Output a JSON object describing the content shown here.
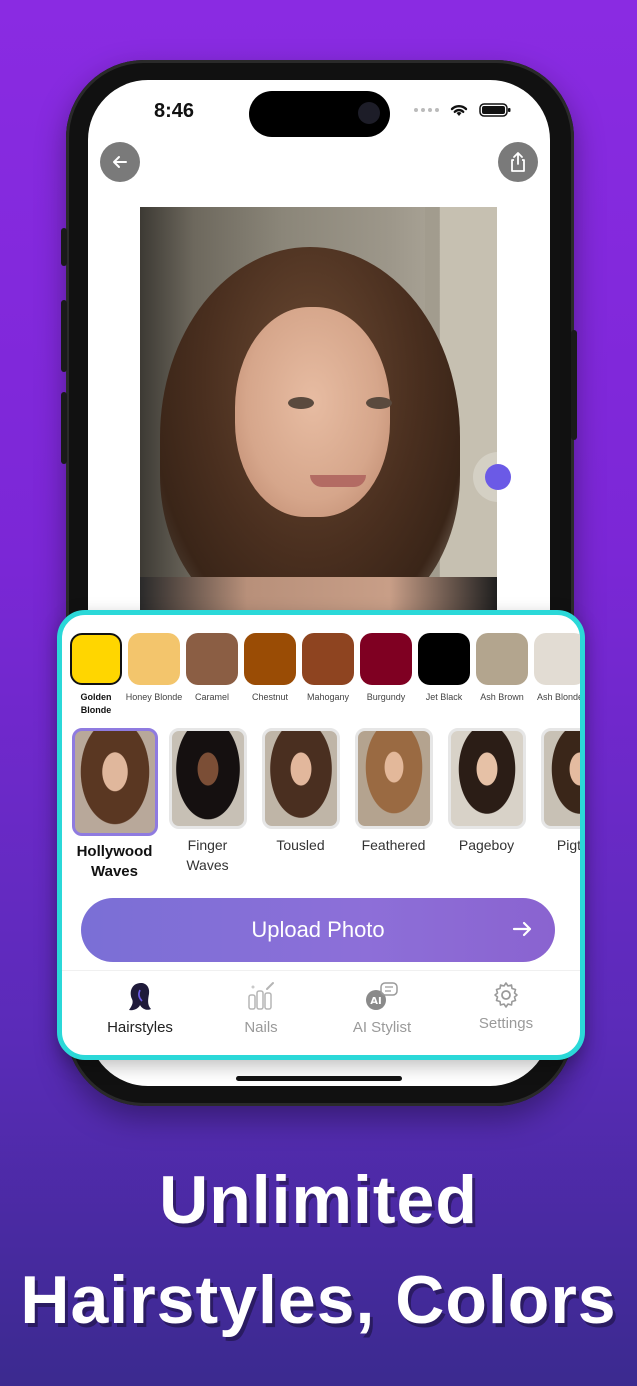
{
  "status": {
    "time": "8:46"
  },
  "colors": {
    "selected_index": 0,
    "items": [
      {
        "label": "Golden Blonde",
        "color": "#ffd600"
      },
      {
        "label": "Honey Blonde",
        "color": "#f3c56c"
      },
      {
        "label": "Caramel",
        "color": "#8b5e44"
      },
      {
        "label": "Chestnut",
        "color": "#9a4c05"
      },
      {
        "label": "Mahogany",
        "color": "#8e4420"
      },
      {
        "label": "Burgundy",
        "color": "#7f0022"
      },
      {
        "label": "Jet Black",
        "color": "#000000"
      },
      {
        "label": "Ash Brown",
        "color": "#b3a58e"
      },
      {
        "label": "Ash Blonde",
        "color": "#e2dcd3"
      }
    ]
  },
  "styles": {
    "selected_index": 0,
    "items": [
      {
        "label": "Hollywood Waves"
      },
      {
        "label": "Finger Waves"
      },
      {
        "label": "Tousled"
      },
      {
        "label": "Feathered"
      },
      {
        "label": "Pageboy"
      },
      {
        "label": "Pigtails"
      }
    ]
  },
  "upload_button": {
    "label": "Upload Photo"
  },
  "tabs": [
    {
      "label": "Hairstyles",
      "icon": "hairstyles-icon",
      "active": true
    },
    {
      "label": "Nails",
      "icon": "nails-icon",
      "active": false
    },
    {
      "label": "AI Stylist",
      "icon": "ai-stylist-icon",
      "active": false
    },
    {
      "label": "Settings",
      "icon": "gear-icon",
      "active": false
    }
  ],
  "headline": {
    "line1": "Unlimited",
    "line2": "Hairstyles, Colors"
  }
}
